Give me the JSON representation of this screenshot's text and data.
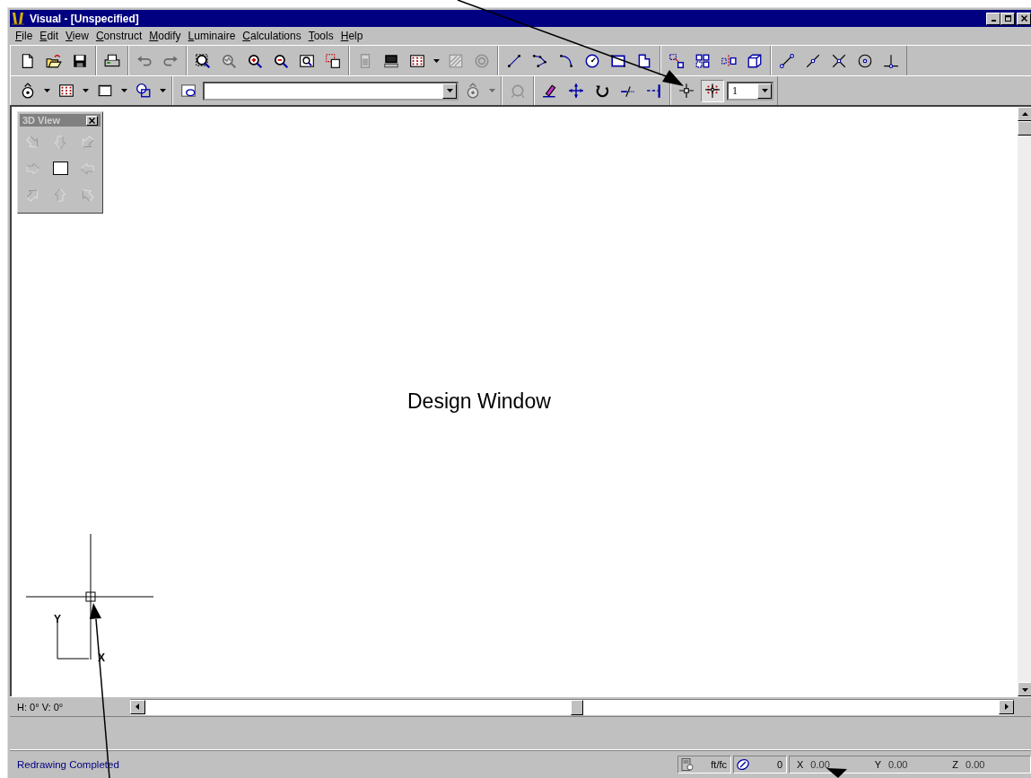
{
  "window": {
    "title": "Visual - [Unspecified]"
  },
  "menu": [
    {
      "label": "File"
    },
    {
      "label": "Edit"
    },
    {
      "label": "View"
    },
    {
      "label": "Construct"
    },
    {
      "label": "Modify"
    },
    {
      "label": "Luminaire"
    },
    {
      "label": "Calculations"
    },
    {
      "label": "Tools"
    },
    {
      "label": "Help"
    }
  ],
  "toolbars": [
    {
      "groups": [
        [
          {
            "kind": "new",
            "disabled": false,
            "pressed": false
          },
          {
            "kind": "open",
            "disabled": false,
            "pressed": false
          },
          {
            "kind": "save",
            "disabled": false,
            "pressed": false
          }
        ],
        [
          {
            "kind": "print",
            "disabled": false,
            "pressed": false
          }
        ],
        [
          {
            "kind": "undo",
            "disabled": true,
            "pressed": false
          },
          {
            "kind": "redo",
            "disabled": true,
            "pressed": false
          }
        ],
        [
          {
            "kind": "zoom-window",
            "disabled": false,
            "pressed": false
          },
          {
            "kind": "zoom-previous",
            "disabled": true,
            "pressed": false
          },
          {
            "kind": "zoom-in",
            "disabled": false,
            "pressed": false
          },
          {
            "kind": "zoom-out",
            "disabled": false,
            "pressed": false
          },
          {
            "kind": "zoom-extents",
            "disabled": false,
            "pressed": false
          },
          {
            "kind": "zoom-pan",
            "disabled": false,
            "pressed": false
          }
        ],
        [
          {
            "kind": "calculator",
            "disabled": true,
            "pressed": false
          },
          {
            "kind": "monitor",
            "disabled": false,
            "pressed": false
          },
          {
            "kind": "grid",
            "disabled": false,
            "pressed": false
          },
          {
            "kind": "dropdown",
            "disabled": false,
            "pressed": false
          },
          {
            "kind": "hatch",
            "disabled": true,
            "pressed": false
          },
          {
            "kind": "target",
            "disabled": true,
            "pressed": false
          }
        ],
        [
          {
            "kind": "line",
            "disabled": false,
            "pressed": false
          },
          {
            "kind": "polyline",
            "disabled": false,
            "pressed": false
          },
          {
            "kind": "arc",
            "disabled": false,
            "pressed": false
          },
          {
            "kind": "circle",
            "disabled": false,
            "pressed": false
          },
          {
            "kind": "rectangle",
            "disabled": false,
            "pressed": false
          },
          {
            "kind": "polygon",
            "disabled": false,
            "pressed": false
          }
        ],
        [
          {
            "kind": "move-copy",
            "disabled": false,
            "pressed": false
          },
          {
            "kind": "array",
            "disabled": false,
            "pressed": false
          },
          {
            "kind": "mirror",
            "disabled": false,
            "pressed": false
          },
          {
            "kind": "extrude",
            "disabled": false,
            "pressed": false
          }
        ],
        [
          {
            "kind": "snap-end",
            "disabled": false,
            "pressed": false
          },
          {
            "kind": "snap-mid",
            "disabled": false,
            "pressed": false
          },
          {
            "kind": "snap-intersect",
            "disabled": false,
            "pressed": false
          },
          {
            "kind": "snap-center",
            "disabled": false,
            "pressed": false
          },
          {
            "kind": "snap-perpendicular",
            "disabled": false,
            "pressed": false
          }
        ]
      ]
    },
    {
      "groups": [
        [
          {
            "kind": "luminaire",
            "disabled": false,
            "pressed": false
          },
          {
            "kind": "dropdown",
            "disabled": false,
            "pressed": false
          },
          {
            "kind": "grid",
            "disabled": false,
            "pressed": false
          },
          {
            "kind": "dropdown",
            "disabled": false,
            "pressed": false
          },
          {
            "kind": "rectangle-plain",
            "disabled": false,
            "pressed": false
          },
          {
            "kind": "dropdown",
            "disabled": false,
            "pressed": false
          },
          {
            "kind": "shapes",
            "disabled": false,
            "pressed": false
          },
          {
            "kind": "dropdown",
            "disabled": false,
            "pressed": false
          }
        ],
        [
          {
            "kind": "layer",
            "disabled": false,
            "pressed": false
          },
          {
            "kind": "combo"
          },
          {
            "kind": "luminaire",
            "disabled": true,
            "pressed": false
          },
          {
            "kind": "dropdown",
            "disabled": true,
            "pressed": false
          }
        ],
        [
          {
            "kind": "rotate-luminaire",
            "disabled": true,
            "pressed": false
          }
        ],
        [
          {
            "kind": "erase",
            "disabled": false,
            "pressed": false
          },
          {
            "kind": "move",
            "disabled": false,
            "pressed": false
          },
          {
            "kind": "rotate",
            "disabled": false,
            "pressed": false
          },
          {
            "kind": "trim",
            "disabled": false,
            "pressed": false
          },
          {
            "kind": "extend",
            "disabled": false,
            "pressed": false
          }
        ],
        [
          {
            "kind": "crosshair",
            "disabled": false,
            "pressed": false
          },
          {
            "kind": "snap-grid",
            "disabled": false,
            "pressed": true
          },
          {
            "kind": "spin",
            "value": "1"
          }
        ]
      ]
    }
  ],
  "palette": {
    "title": "3D View",
    "buttons": [
      {
        "kind": "arrow-se",
        "disabled": true
      },
      {
        "kind": "arrow-s",
        "disabled": true
      },
      {
        "kind": "arrow-sw",
        "disabled": true
      },
      {
        "kind": "arrow-e",
        "disabled": true
      },
      {
        "kind": "square"
      },
      {
        "kind": "arrow-w",
        "disabled": true
      },
      {
        "kind": "arrow-ne",
        "disabled": true
      },
      {
        "kind": "arrow-n",
        "disabled": true
      },
      {
        "kind": "arrow-nw",
        "disabled": true
      }
    ]
  },
  "design_window": {
    "label": "Design Window",
    "axis": {
      "y_label": "Y",
      "x_label": "X"
    }
  },
  "view_angles": "H: 0°  V: 0°",
  "status_bar": {
    "message": "Redrawing Completed",
    "units": "ft/fc",
    "count": "0",
    "coords": [
      {
        "axis": "X",
        "value": "0.00"
      },
      {
        "axis": "Y",
        "value": "0.00"
      },
      {
        "axis": "Z",
        "value": "0.00"
      }
    ]
  }
}
